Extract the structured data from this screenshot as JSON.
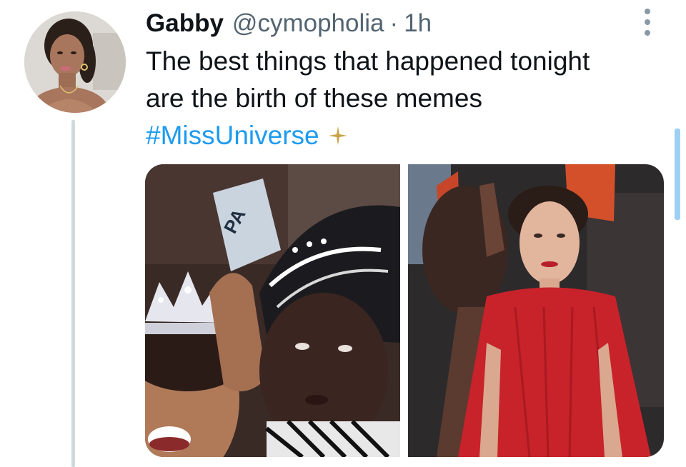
{
  "tweet": {
    "author": {
      "display_name": "Gabby",
      "handle": "@cymopholia",
      "avatar_icon": "profile-photo"
    },
    "separator": "·",
    "time": "1h",
    "text_lines": [
      "The best things that happened tonight",
      "are the birth of these memes"
    ],
    "hashtag": "#MissUniverse",
    "hashtag_color": "#1d9bf0",
    "hashtag_emoji_icon": "sparkle-icon",
    "more_icon": "more-vertical-icon",
    "media": [
      {
        "name": "crowning-photo"
      },
      {
        "name": "red-dress-photo"
      }
    ]
  },
  "colors": {
    "text_primary": "#0f1419",
    "text_secondary": "#536471",
    "link": "#1d9bf0",
    "thread_line": "#cfd9de",
    "scrollbar": "#9ed0f5"
  }
}
